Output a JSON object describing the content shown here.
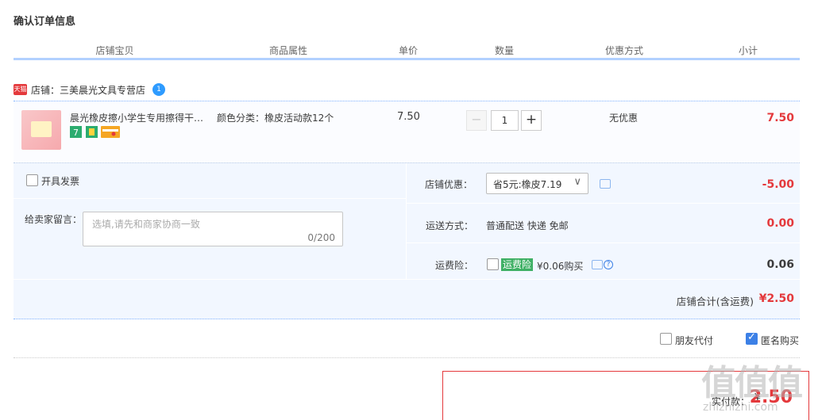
{
  "page_title": "确认订单信息",
  "table_headers": [
    "店铺宝贝",
    "商品属性",
    "单价",
    "数量",
    "优惠方式",
    "小计"
  ],
  "shop": {
    "badge": "天猫",
    "label": "店铺：三美晨光文具专营店",
    "chat_badge": "1"
  },
  "item": {
    "name": "晨光橡皮擦小学生专用擦得干净不留痕迹",
    "sku": "颜色分类：橡皮活动款12个",
    "price": "7.50",
    "qty_minus": "−",
    "qty": "1",
    "qty_plus": "+",
    "promo": "无优惠",
    "subtotal": "7.50",
    "service_icons": [
      "seven-day-return-icon",
      "warranty-icon",
      "credit-card-icon"
    ]
  },
  "options": {
    "invoice_label": "开具发票",
    "memo_label": "给卖家留言：",
    "memo_placeholder": "选填,请先和商家协商一致",
    "memo_count": "0/200",
    "shop_coupon_label": "店铺优惠：",
    "shop_coupon_value": "省5元:橡皮7.19",
    "shop_coupon_caret": "∨",
    "shop_coupon_amount": "-5.00",
    "shipping_label": "运送方式：",
    "shipping_value": "普通配送 快递 免邮",
    "shipping_amount": "0.00",
    "insurance_label": "运费险：",
    "insurance_tag": "运费险",
    "insurance_value": "¥0.06购买",
    "insurance_help": "?",
    "insurance_amount": "0.06"
  },
  "shop_total": {
    "label": "店铺合计(含运费)",
    "amount": "¥2.50"
  },
  "pay_options": {
    "friend_pay": "朋友代付",
    "anonymous": "匿名购买"
  },
  "actual": {
    "label": "实付款：",
    "yen": "¥",
    "amount": "2.50"
  },
  "watermark": {
    "text": "值值值",
    "url": "zhizhizhi.com"
  },
  "colors": {
    "accent_blue": "#3c80e6",
    "price_red": "#e4393c",
    "header_border": "#b2d1ff",
    "panel_bg": "#f2f7ff"
  }
}
